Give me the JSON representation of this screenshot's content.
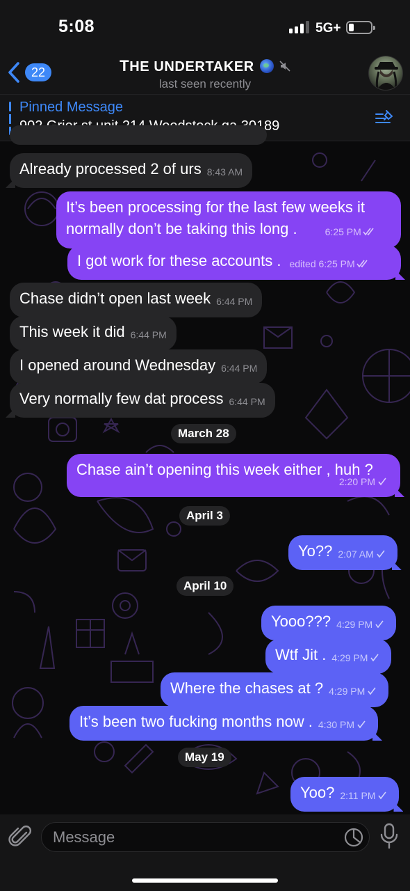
{
  "status_bar": {
    "time": "5:08",
    "network": "5G+"
  },
  "header": {
    "back_badge": "22",
    "title_first": "T",
    "title_rest": "HE UNDERTAKER",
    "subtitle": "last seen recently"
  },
  "pinned": {
    "label": "Pinned Message",
    "text": "902 Grier st unit 214 Woodstock ga 30189"
  },
  "messages": [
    {
      "side": "in",
      "text": "Already processed 2 of urs",
      "time": "8:43 AM"
    },
    {
      "side": "out",
      "text": "It’s been processing for the last few weeks it",
      "text2": "normally don’t be taking this long .",
      "time": "6:25 PM"
    },
    {
      "side": "out",
      "text": "I got work for these accounts .",
      "edited": "edited",
      "time": "6:25 PM"
    },
    {
      "side": "in",
      "text": "Chase didn’t open last week",
      "time": "6:44 PM"
    },
    {
      "side": "in",
      "text": "This week it did",
      "time": "6:44 PM"
    },
    {
      "side": "in",
      "text": "I opened around Wednesday",
      "time": "6:44 PM"
    },
    {
      "side": "in",
      "text": "Very normally few dat process",
      "time": "6:44 PM"
    },
    {
      "side": "out",
      "text": "Chase ain’t opening this week either , huh ?",
      "time": "2:20 PM"
    },
    {
      "side": "out",
      "text": "Yo??",
      "time": "2:07 AM"
    },
    {
      "side": "out",
      "text": "Yooo???",
      "time": "4:29 PM"
    },
    {
      "side": "out",
      "text": "Wtf Jit .",
      "time": "4:29 PM"
    },
    {
      "side": "out",
      "text": "Where the chases at ?",
      "time": "4:29 PM"
    },
    {
      "side": "out",
      "text": "It’s been two fucking months now .",
      "time": "4:30 PM"
    },
    {
      "side": "out",
      "text": "Yoo?",
      "time": "2:11 PM"
    }
  ],
  "dates": [
    "March 28",
    "April 3",
    "April 10",
    "May 19"
  ],
  "input": {
    "placeholder": "Message"
  },
  "colors": {
    "accent": "#3e88f7",
    "outgoing": "#8644f4",
    "incoming": "#262628"
  }
}
